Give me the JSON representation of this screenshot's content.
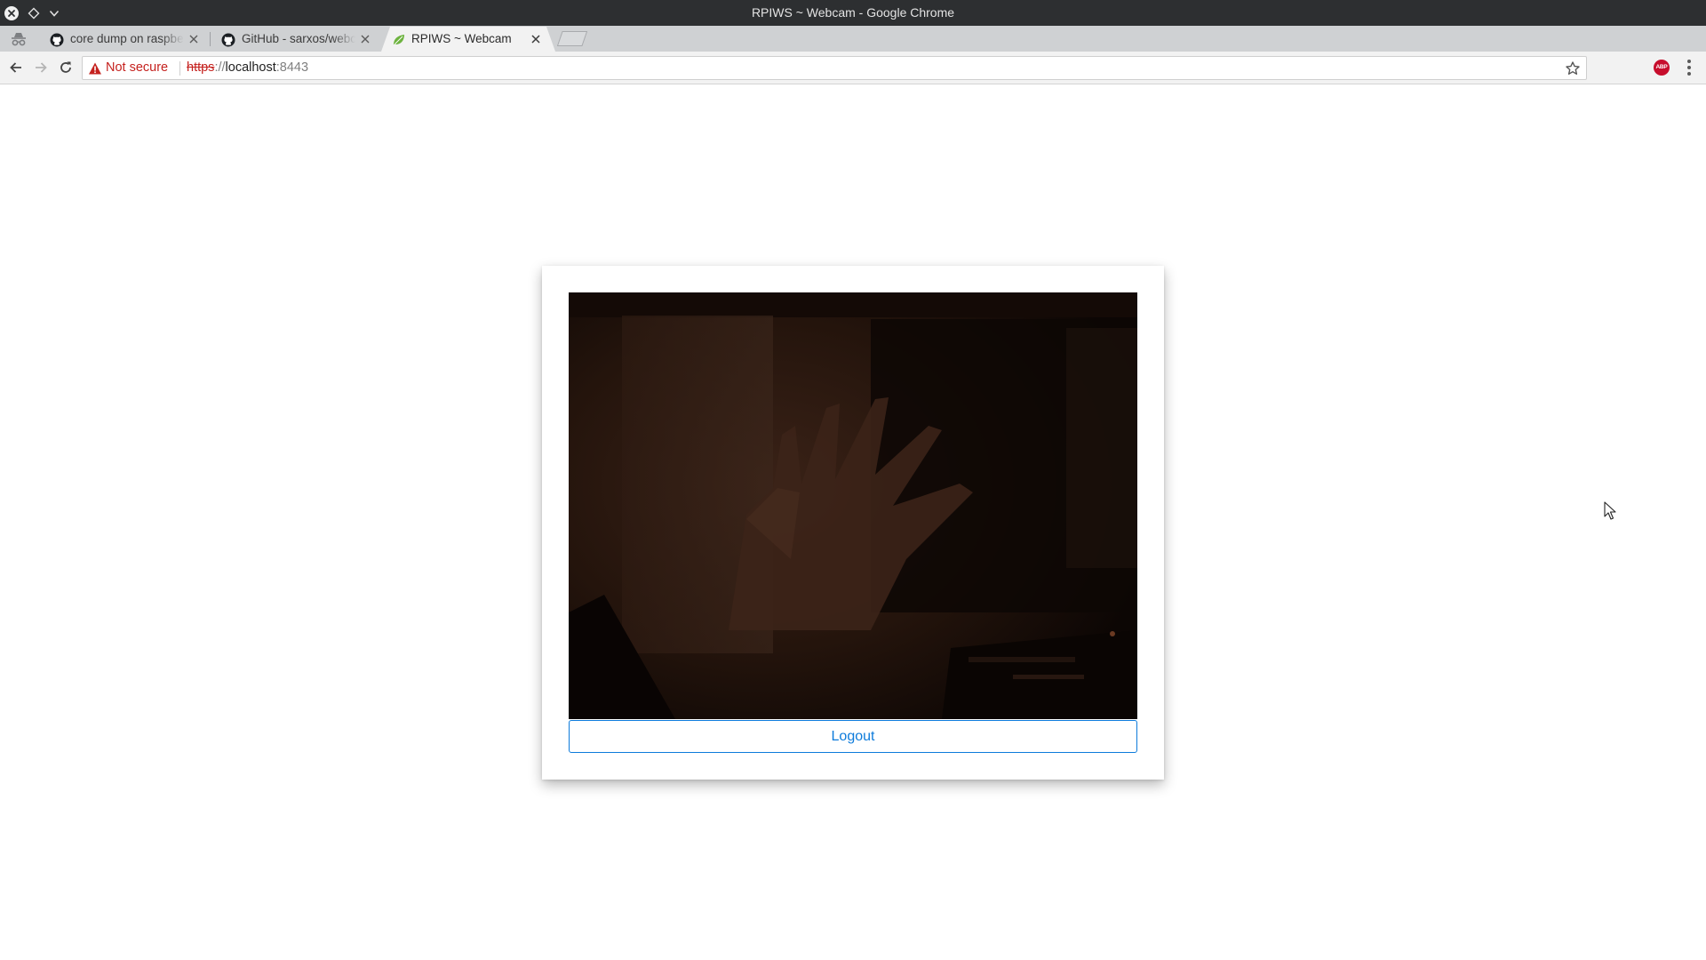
{
  "window": {
    "title": "RPIWS ~ Webcam - Google Chrome"
  },
  "tabs": [
    {
      "label": "core dump on raspberry",
      "favicon": "github-icon",
      "active": false
    },
    {
      "label": "GitHub - sarxos/webcam",
      "favicon": "github-icon",
      "active": false
    },
    {
      "label": "RPIWS ~ Webcam",
      "favicon": "spring-leaf-icon",
      "active": true
    }
  ],
  "toolbar": {
    "security_label": "Not secure",
    "url": {
      "scheme": "https",
      "separator": "://",
      "host": "localhost",
      "port": ":8443"
    }
  },
  "extensions": {
    "adblock_label": "ABP"
  },
  "page": {
    "logout_label": "Logout"
  },
  "colors": {
    "accent": "#0d7bdb",
    "warning": "#c5221f",
    "adblock": "#c70d2c"
  }
}
